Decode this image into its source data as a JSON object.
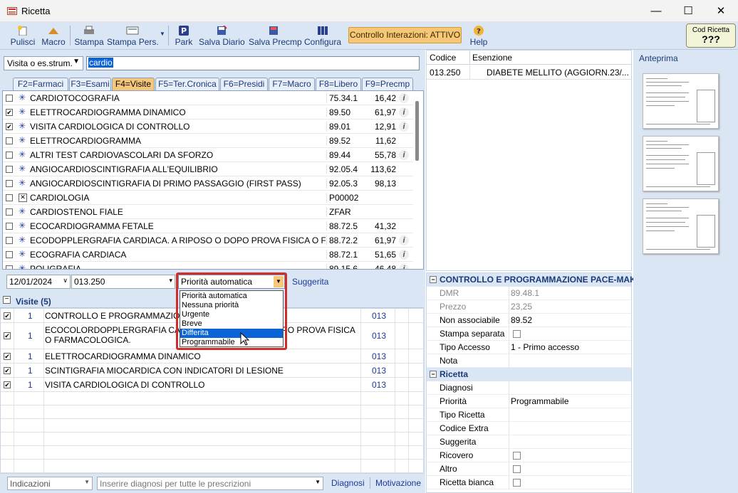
{
  "window": {
    "title": "Ricetta"
  },
  "toolbar": {
    "pulisci": "Pulisci",
    "macro": "Macro",
    "stampa": "Stampa",
    "stampa_pers": "Stampa Pers.",
    "park": "Park",
    "salva_diario": "Salva Diario",
    "salva_precmp": "Salva Precmp",
    "configura": "Configura",
    "controllo_interazioni": "Controllo Interazioni: ATTIVO",
    "help": "Help",
    "cod_ricetta_label": "Cod Ricetta",
    "cod_ricetta_value": "???"
  },
  "search": {
    "type": "Visita o es.strum.",
    "query": "cardio"
  },
  "tabs": [
    "F2=Farmaci",
    "F3=Esami",
    "F4=Visite",
    "F5=Ter.Cronica",
    "F6=Presidi",
    "F7=Macro",
    "F8=Libero",
    "F9=Precmp"
  ],
  "active_tab": "F4=Visite",
  "results": [
    {
      "checked": false,
      "name": "CARDIOTOCOGRAFIA",
      "code": "75.34.1",
      "price": "16,42",
      "info": true
    },
    {
      "checked": true,
      "name": "ELETTROCARDIOGRAMMA DINAMICO",
      "code": "89.50",
      "price": "61,97",
      "info": true
    },
    {
      "checked": true,
      "name": "VISITA CARDIOLOGICA DI CONTROLLO",
      "code": "89.01",
      "price": "12,91",
      "info": true
    },
    {
      "checked": false,
      "name": "ELETTROCARDIOGRAMMA",
      "code": "89.52",
      "price": "11,62",
      "info": false
    },
    {
      "checked": false,
      "name": "ALTRI TEST CARDIOVASCOLARI DA SFORZO",
      "code": "89.44",
      "price": "55,78",
      "info": true
    },
    {
      "checked": false,
      "name": "ANGIOCARDIOSCINTIGRAFIA ALL'EQUILIBRIO",
      "code": "92.05.4",
      "price": "113,62",
      "info": false
    },
    {
      "checked": false,
      "name": "ANGIOCARDIOSCINTIGRAFIA DI PRIMO PASSAGGIO (FIRST PASS)",
      "code": "92.05.3",
      "price": "98,13",
      "info": false
    },
    {
      "checked": false,
      "name": "CARDIOLOGIA",
      "code": "P00002",
      "price": "",
      "info": false,
      "x": true
    },
    {
      "checked": false,
      "name": "CARDIOSTENOL FIALE",
      "code": "ZFAR",
      "price": "",
      "info": false
    },
    {
      "checked": false,
      "name": "ECOCARDIOGRAMMA FETALE",
      "code": "88.72.5",
      "price": "41,32",
      "info": false
    },
    {
      "checked": false,
      "name": "ECODOPPLERGRAFIA CARDIACA. A RIPOSO O DOPO PROVA FISICA O FARM...",
      "code": "88.72.2",
      "price": "61,97",
      "info": true
    },
    {
      "checked": false,
      "name": "ECOGRAFIA CARDIACA",
      "code": "88.72.1",
      "price": "51,65",
      "info": true
    },
    {
      "checked": false,
      "name": "POLIGRAFIA",
      "code": "89.15.6",
      "price": "46,48",
      "info": true
    }
  ],
  "entry": {
    "date": "12/01/2024",
    "code": "013.250",
    "priority": "Priorità automatica",
    "suggerita": "Suggerita"
  },
  "priority_options": [
    "Priorità automatica",
    "Nessuna priorità",
    "Urgente",
    "Breve",
    "Differita",
    "Programmabile"
  ],
  "priority_highlight": "Differita",
  "visite": {
    "header": "Visite (5)",
    "rows": [
      {
        "qty": "1",
        "name": "CONTROLLO E PROGRAMMAZIONE PACE-MAKER",
        "code": "013"
      },
      {
        "qty": "1",
        "name": "ECOCOLORDOPPLERGRAFIA CARDIACA. A RIPOSO O DOPO PROVA FISICA O FARMACOLOGICA.",
        "code": "013"
      },
      {
        "qty": "1",
        "name": "ELETTROCARDIOGRAMMA DINAMICO",
        "code": "013"
      },
      {
        "qty": "1",
        "name": "SCINTIGRAFIA MIOCARDICA CON INDICATORI DI LESIONE",
        "code": "013"
      },
      {
        "qty": "1",
        "name": "VISITA CARDIOLOGICA DI CONTROLLO",
        "code": "013"
      }
    ]
  },
  "footer": {
    "indicazioni": "Indicazioni",
    "diagnosi_placeholder": "Inserire diagnosi per tutte le prescrizioni",
    "diagnosi": "Diagnosi",
    "motivazione": "Motivazione"
  },
  "esenzioni": {
    "col_codice": "Codice",
    "col_esenzione": "Esenzione",
    "rows": [
      {
        "code": "013.250",
        "desc": "DIABETE MELLITO (AGGIORN.23/..."
      }
    ]
  },
  "properties": {
    "group1": "CONTROLLO E PROGRAMMAZIONE PACE-MAKER",
    "dmr_label": "DMR",
    "dmr": "89.48.1",
    "prezzo_label": "Prezzo",
    "prezzo": "23,25",
    "non_assoc_label": "Non associabile",
    "non_assoc": "89.52",
    "stampa_sep_label": "Stampa separata",
    "tipo_accesso_label": "Tipo Accesso",
    "tipo_accesso": "1 - Primo accesso",
    "nota_label": "Nota",
    "group2": "Ricetta",
    "diagnosi_label": "Diagnosi",
    "priorita_label": "Priorità",
    "priorita": "Programmabile",
    "tipo_ricetta_label": "Tipo Ricetta",
    "codice_extra_label": "Codice Extra",
    "suggerita_label": "Suggerita",
    "ricovero_label": "Ricovero",
    "altro_label": "Altro",
    "ricetta_bianca_label": "Ricetta bianca"
  },
  "preview": {
    "title": "Anteprima"
  },
  "colors": {
    "accent_orange": "#f6c77a",
    "panel_blue": "#dbe6f4",
    "selection": "#0a64d6",
    "highlight_border": "#d02d2d"
  }
}
